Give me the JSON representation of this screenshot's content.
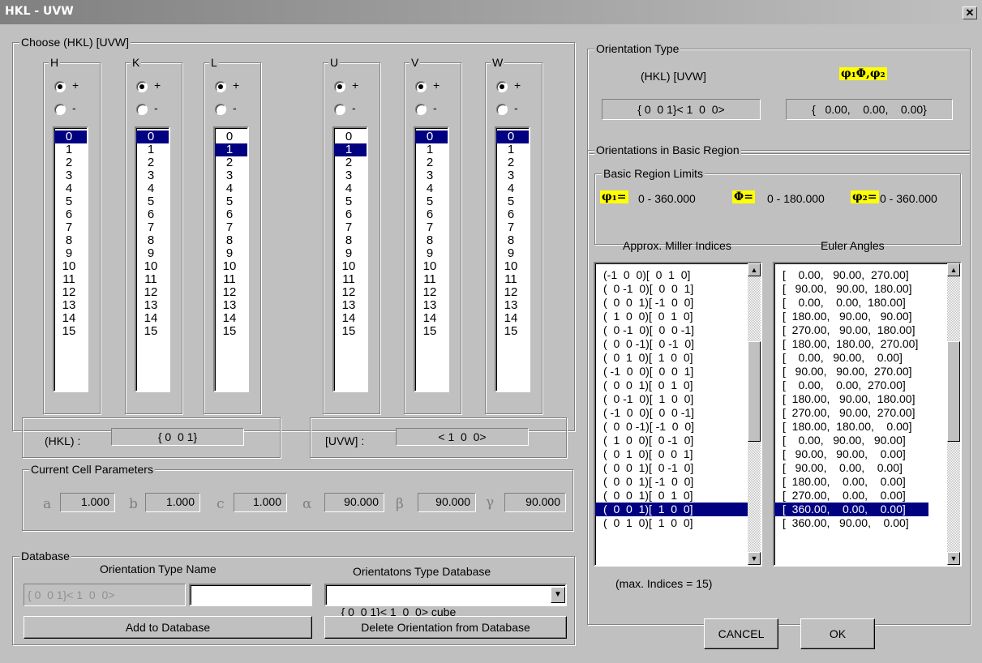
{
  "window": {
    "title": "HKL - UVW",
    "close_label": "✕"
  },
  "choose": {
    "group_label": "Choose (HKL)  [UVW]",
    "plus": "+",
    "minus": "-",
    "columns": [
      {
        "label": "H",
        "radio": "+",
        "selected": "0"
      },
      {
        "label": "K",
        "radio": "+",
        "selected": "0"
      },
      {
        "label": "L",
        "radio": "+",
        "selected": "1"
      },
      {
        "label": "U",
        "radio": "+",
        "selected": "1"
      },
      {
        "label": "V",
        "radio": "+",
        "selected": "0"
      },
      {
        "label": "W",
        "radio": "+",
        "selected": "0"
      }
    ],
    "items": [
      "0",
      "1",
      "2",
      "3",
      "4",
      "5",
      "6",
      "7",
      "8",
      "9",
      "10",
      "11",
      "12",
      "13",
      "14",
      "15"
    ],
    "hkl_label": "(HKL) :",
    "hkl_value": "{ 0  0 1}",
    "uvw_label": "[UVW] :",
    "uvw_value": "< 1  0  0>"
  },
  "cell": {
    "group_label": "Current Cell Parameters",
    "a_sym": "a",
    "a": "1.000",
    "b_sym": "b",
    "b": "1.000",
    "c_sym": "c",
    "c": "1.000",
    "alpha_sym": "α",
    "alpha": "90.000",
    "beta_sym": "β",
    "beta": "90.000",
    "gamma_sym": "γ",
    "gamma": "90.000"
  },
  "database": {
    "group_label": "Database",
    "name_label": "Orientation Type Name",
    "db_label": "Orientatons Type Database",
    "name_readonly": "{ 0  0 1}< 1  0  0>",
    "name_input": "",
    "db_selected": "{ 0  0 1}< 1  0  0> cube",
    "add_button": "Add to Database",
    "delete_button": "Delete Orientation from Database"
  },
  "orientation_type": {
    "group_label": "Orientation Type",
    "hkl_uvw_label": "(HKL) [UVW]",
    "euler_label": "φ₁Φ,φ₂",
    "hkl_uvw_value": "{ 0  0 1}< 1  0  0>",
    "euler_value": "{   0.00,    0.00,    0.00}"
  },
  "basic_region": {
    "group_label": "Orientations in Basic Region",
    "limits_label": "Basic Region Limits",
    "phi1_sym": "φ₁=",
    "phi1_range": "0 -   360.000",
    "Phi_sym": "Φ=",
    "Phi_range": "0 -  180.000",
    "phi2_sym": "φ₂=",
    "phi2_range": "0 -  360.000",
    "miller_header": "Approx. Miller Indices",
    "euler_header": "Euler Angles",
    "max_indices": "(max. Indices = 15)",
    "miller_items": [
      "(-1  0  0)[  0  1  0]",
      "(  0 -1  0)[  0  0  1]",
      "(  0  0  1)[ -1  0  0]",
      "(  1  0  0)[  0  1  0]",
      "(  0 -1  0)[  0  0 -1]",
      "(  0  0 -1)[  0 -1  0]",
      "(  0  1  0)[  1  0  0]",
      "( -1  0  0)[  0  0  1]",
      "(  0  0  1)[  0  1  0]",
      "(  0 -1  0)[  1  0  0]",
      "( -1  0  0)[  0  0 -1]",
      "(  0  0 -1)[ -1  0  0]",
      "(  1  0  0)[  0 -1  0]",
      "(  0  1  0)[  0  0  1]",
      "(  0  0  1)[  0 -1  0]",
      "(  0  0  1)[ -1  0  0]",
      "(  0  0  1)[  0  1  0]",
      "(  0  0  1)[  1  0  0]",
      "(  0  1  0)[  1  0  0]"
    ],
    "euler_items": [
      "[    0.00,   90.00,  270.00]",
      "[   90.00,   90.00,  180.00]",
      "[    0.00,    0.00,  180.00]",
      "[  180.00,   90.00,   90.00]",
      "[  270.00,   90.00,  180.00]",
      "[  180.00,  180.00,  270.00]",
      "[    0.00,   90.00,    0.00]",
      "[   90.00,   90.00,  270.00]",
      "[    0.00,    0.00,  270.00]",
      "[  180.00,   90.00,  180.00]",
      "[  270.00,   90.00,  270.00]",
      "[  180.00,  180.00,    0.00]",
      "[    0.00,   90.00,   90.00]",
      "[   90.00,   90.00,    0.00]",
      "[   90.00,    0.00,    0.00]",
      "[  180.00,    0.00,    0.00]",
      "[  270.00,    0.00,    0.00]",
      "[  360.00,    0.00,    0.00]",
      "[  360.00,   90.00,    0.00]"
    ],
    "selected_index": 17
  },
  "buttons": {
    "cancel": "CANCEL",
    "ok": "OK"
  }
}
